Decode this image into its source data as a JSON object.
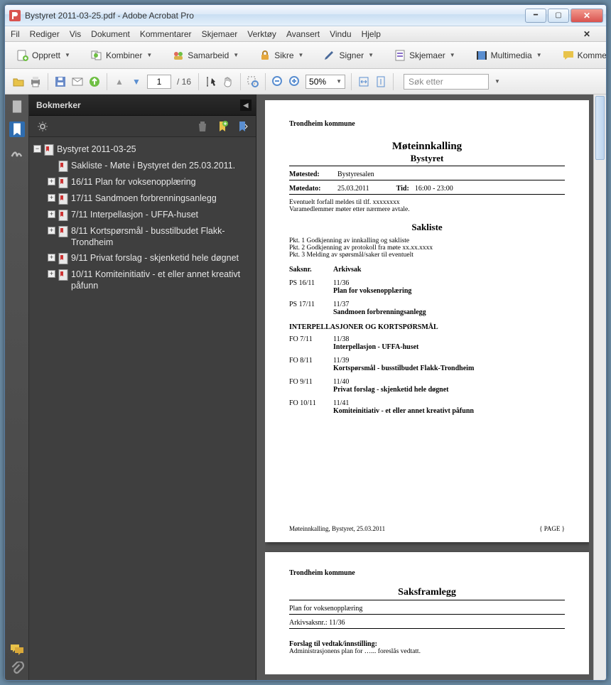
{
  "window": {
    "title": "Bystyret 2011-03-25.pdf - Adobe Acrobat Pro"
  },
  "menu": [
    "Fil",
    "Rediger",
    "Vis",
    "Dokument",
    "Kommentarer",
    "Skjemaer",
    "Verktøy",
    "Avansert",
    "Vindu",
    "Hjelp"
  ],
  "toolbar1": {
    "create": "Opprett",
    "combine": "Kombiner",
    "collab": "Samarbeid",
    "secure": "Sikre",
    "sign": "Signer",
    "forms": "Skjemaer",
    "multimedia": "Multimedia",
    "comment": "Kommentar"
  },
  "toolbar2": {
    "page_current": "1",
    "page_total": "/ 16",
    "zoom": "50%",
    "search_placeholder": "Søk etter"
  },
  "panel": {
    "title": "Bokmerker"
  },
  "bookmarks": {
    "root": "Bystyret 2011-03-25",
    "items": [
      {
        "label": "Sakliste - Møte i Bystyret den 25.03.2011.",
        "expandable": false
      },
      {
        "label": "16/11 Plan for voksenopplæring",
        "expandable": true
      },
      {
        "label": "17/11 Sandmoen forbrenningsanlegg",
        "expandable": true
      },
      {
        "label": "7/11 Interpellasjon - UFFA-huset",
        "expandable": true
      },
      {
        "label": "8/11 Kortspørsmål - busstilbudet Flakk-Trondheim",
        "expandable": true
      },
      {
        "label": "9/11 Privat forslag - skjenketid hele døgnet",
        "expandable": true
      },
      {
        "label": "10/11 Komiteinitiativ - et eller annet kreativt påfunn",
        "expandable": true
      }
    ]
  },
  "doc": {
    "kommune": "Trondheim kommune",
    "moteinnkalling": "Møteinnkalling",
    "bystyret": "Bystyret",
    "motested_lbl": "Møtested:",
    "motested": "Bystyresalen",
    "motedato_lbl": "Møtedato:",
    "motedato": "25.03.2011",
    "tid_lbl": "Tid:",
    "tid": "16:00 - 23:00",
    "forfall1": "Eventuelt forfall meldes til tlf. xxxxxxxx",
    "forfall2": "Varamedlemmer møter etter nærmere avtale.",
    "sakliste": "Sakliste",
    "pkt1": "Pkt. 1  Godkjenning av innkalling og sakliste",
    "pkt2": "Pkt. 2  Godkjenning av protokoll fra møte xx.xx.xxxx",
    "pkt3": "Pkt. 3  Melding av spørsmål/saker til eventuelt",
    "col1": "Saksnr.",
    "col2": "Arkivsak",
    "rows": [
      {
        "c1": "PS 16/11",
        "ark": "11/36",
        "title": "Plan for voksenopplæring"
      },
      {
        "c1": "PS 17/11",
        "ark": "11/37",
        "title": "Sandmoen forbrenningsanlegg"
      }
    ],
    "section": "INTERPELLASJONER OG KORTSPØRSMÅL",
    "rows2": [
      {
        "c1": "FO 7/11",
        "ark": "11/38",
        "title": "Interpellasjon - UFFA-huset"
      },
      {
        "c1": "FO 8/11",
        "ark": "11/39",
        "title": "Kortspørsmål - busstilbudet Flakk-Trondheim"
      },
      {
        "c1": "FO 9/11",
        "ark": "11/40",
        "title": "Privat forslag - skjenketid hele døgnet"
      },
      {
        "c1": "FO 10/11",
        "ark": "11/41",
        "title": "Komiteinitiativ - et eller annet kreativt påfunn"
      }
    ],
    "footer_left": "Møteinnkalling, Bystyret, 25.03.2011",
    "footer_right": "{ PAGE }",
    "page2": {
      "saksframlegg": "Saksframlegg",
      "line1": "Plan for voksenopplæring",
      "line2": "Arkivsaksnr.: 11/36",
      "forslag_lbl": "Forslag til vedtak/innstilling:",
      "forslag": "Administrasjonens plan for …... foreslås vedtatt."
    }
  }
}
